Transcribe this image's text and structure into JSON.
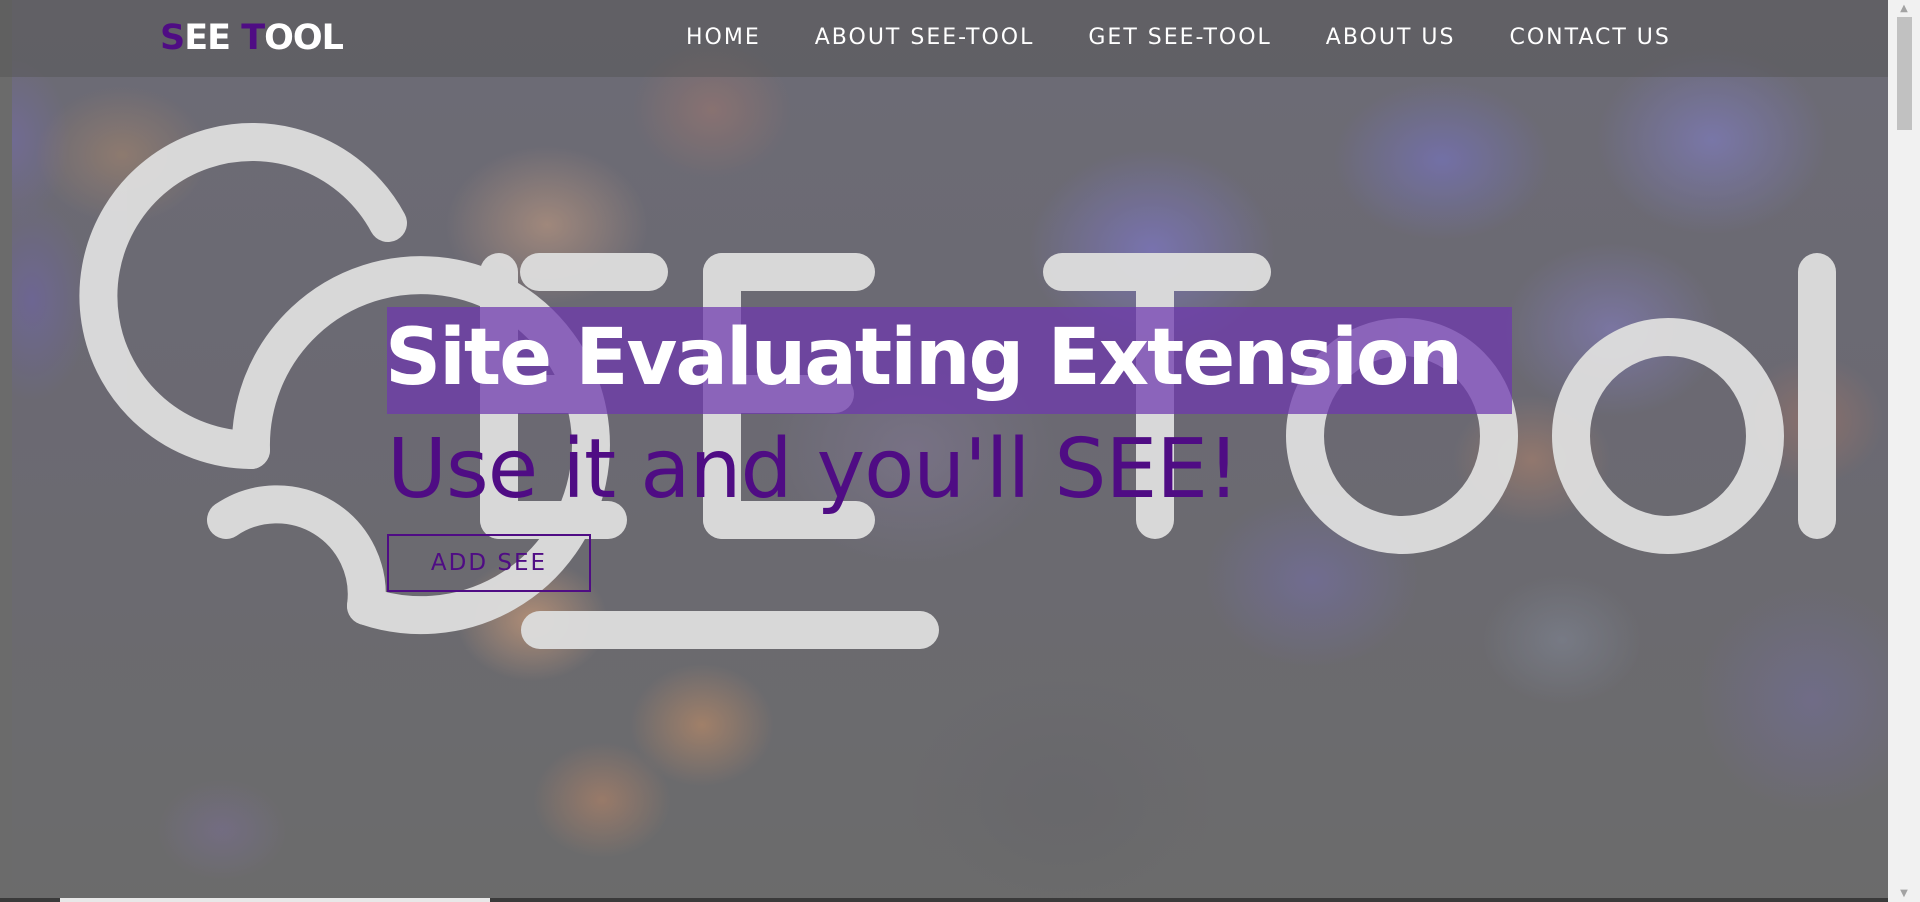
{
  "brand": {
    "part1_accent": "S",
    "part1_rest": "EE ",
    "part2_accent": "T",
    "part2_rest": "OOL",
    "accent_color": "#4f0c84"
  },
  "nav": {
    "items": [
      {
        "label": "HOME"
      },
      {
        "label": "ABOUT SEE-TOOL"
      },
      {
        "label": "GET SEE-TOOL"
      },
      {
        "label": "ABOUT US"
      },
      {
        "label": "CONTACT US"
      }
    ]
  },
  "hero": {
    "headline": "Site Evaluating Extension",
    "tagline": "Use it and you'll SEE!",
    "cta_label": "ADD SEE",
    "headline_bg_color": "#6e37af",
    "tagline_color": "#4f0c84"
  },
  "scrollbar": {
    "up_icon": "scroll-up-arrow-icon",
    "down_icon": "scroll-down-arrow-icon"
  }
}
